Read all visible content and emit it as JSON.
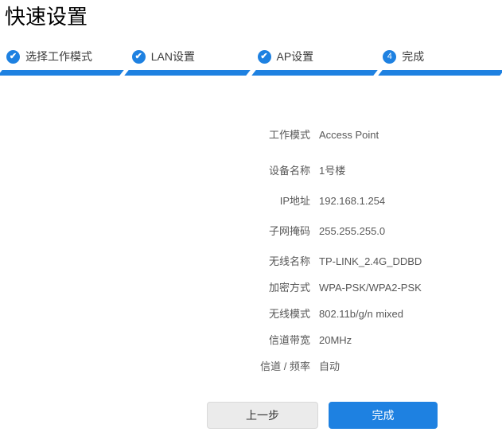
{
  "page": {
    "title": "快速设置"
  },
  "colors": {
    "accent": "#1E81E1"
  },
  "icons": {
    "check": "✔"
  },
  "steps": [
    {
      "label": "选择工作模式",
      "state": "done",
      "badge": "check"
    },
    {
      "label": "LAN设置",
      "state": "done",
      "badge": "check"
    },
    {
      "label": "AP设置",
      "state": "done",
      "badge": "check"
    },
    {
      "label": "完成",
      "state": "current",
      "badge": "4"
    }
  ],
  "summary": {
    "groups": [
      {
        "rows": [
          {
            "label": "工作模式",
            "value": "Access Point"
          }
        ]
      },
      {
        "rows": [
          {
            "label": "设备名称",
            "value": "1号楼"
          },
          {
            "label": "IP地址",
            "value": "192.168.1.254"
          },
          {
            "label": "子网掩码",
            "value": "255.255.255.0"
          }
        ]
      },
      {
        "rows": [
          {
            "label": "无线名称",
            "value": "TP-LINK_2.4G_DDBD"
          },
          {
            "label": "加密方式",
            "value": "WPA-PSK/WPA2-PSK"
          },
          {
            "label": "无线模式",
            "value": "802.11b/g/n mixed"
          },
          {
            "label": "信道带宽",
            "value": "20MHz"
          },
          {
            "label": "信道 / 频率",
            "value": "自动"
          }
        ]
      }
    ]
  },
  "buttons": {
    "back": "上一步",
    "finish": "完成"
  }
}
